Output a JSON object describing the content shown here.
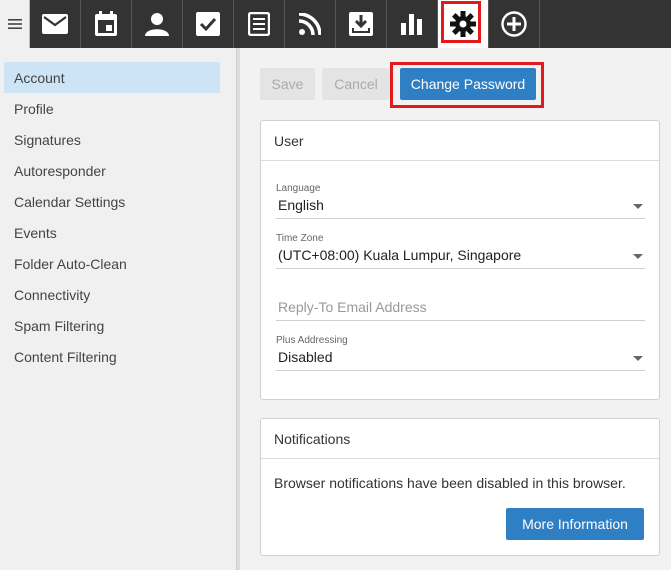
{
  "toolbar": {
    "icons": [
      "menu-icon",
      "mail-icon",
      "calendar-icon",
      "contacts-icon",
      "tasks-icon",
      "notes-icon",
      "rss-icon",
      "archive-icon",
      "reports-icon",
      "settings-icon",
      "add-icon"
    ],
    "active": "settings-icon"
  },
  "sidebar": {
    "items": [
      {
        "label": "Account",
        "selected": true
      },
      {
        "label": "Profile"
      },
      {
        "label": "Signatures"
      },
      {
        "label": "Autoresponder"
      },
      {
        "label": "Calendar Settings"
      },
      {
        "label": "Events"
      },
      {
        "label": "Folder Auto-Clean"
      },
      {
        "label": "Connectivity"
      },
      {
        "label": "Spam Filtering"
      },
      {
        "label": "Content Filtering"
      }
    ]
  },
  "actions": {
    "save_label": "Save",
    "cancel_label": "Cancel",
    "change_password_label": "Change Password"
  },
  "user_section": {
    "title": "User",
    "language_label": "Language",
    "language_value": "English",
    "timezone_label": "Time Zone",
    "timezone_value": "(UTC+08:00) Kuala Lumpur, Singapore",
    "reply_to_placeholder": "Reply-To Email Address",
    "plus_addressing_label": "Plus Addressing",
    "plus_addressing_value": "Disabled"
  },
  "notifications_section": {
    "title": "Notifications",
    "message": "Browser notifications have been disabled in this browser.",
    "more_info_label": "More Information"
  },
  "colors": {
    "accent": "#2f7fc4",
    "highlight": "#e11b1b",
    "toolbar_bg": "#333333",
    "selected_bg": "#cce4f5"
  }
}
